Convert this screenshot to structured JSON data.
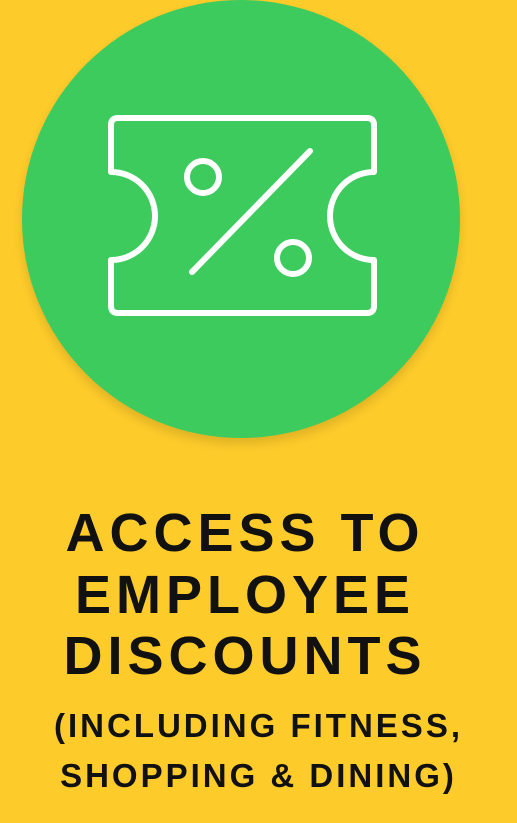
{
  "icon": {
    "name": "discount-ticket-icon"
  },
  "colors": {
    "background": "#FDCB2A",
    "badge": "#3DCB5E",
    "icon_stroke": "#FFFFFF",
    "text": "#111111"
  },
  "heading": {
    "line1": "ACCESS TO",
    "line2": "EMPLOYEE",
    "line3": "DISCOUNTS"
  },
  "subheading": {
    "line1": "(INCLUDING FITNESS,",
    "line2": "SHOPPING & DINING)"
  }
}
